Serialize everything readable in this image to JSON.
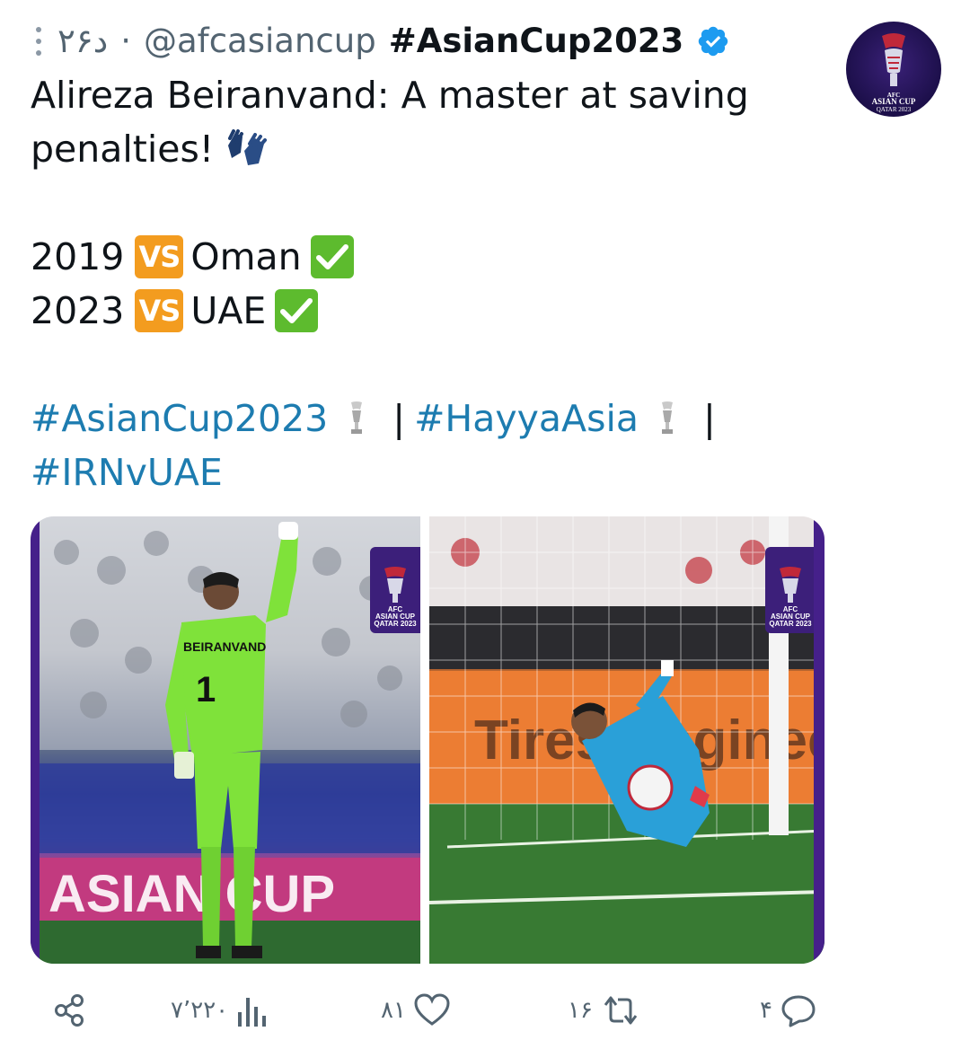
{
  "header": {
    "time": "۲۶د",
    "dot": "·",
    "handle": "@afcasiancup",
    "hashtag_display": "#AsianCup2023"
  },
  "tweet": {
    "line1": "Alireza Beiranvand: A master at saving",
    "line2": "penalties!",
    "match1_year": "2019",
    "match1_opponent": "Oman",
    "match2_year": "2023",
    "match2_opponent": "UAE",
    "vs_label": "VS",
    "hashtag1": "#AsianCup2023",
    "hashtag2": "#HayyaAsia",
    "hashtag3": "#IRNvUAE",
    "separator": "|"
  },
  "media": {
    "logo_line1": "AFC",
    "logo_line2": "ASIAN CUP",
    "logo_line3": "QATAR 2023",
    "left_jersey_name": "BEIRANVAND",
    "left_jersey_number": "1",
    "left_board_text": "ASIAN CUP",
    "right_board_text": "Tires Engineer"
  },
  "actions": {
    "views": "۷٬۲۲۰",
    "likes": "۸۱",
    "retweets": "۱۶",
    "replies": "۴"
  },
  "colors": {
    "hashtag": "#1d7cb0",
    "verified": "#1d9bf0",
    "vs_badge": "#f39c1f",
    "check_badge": "#5dbb2e",
    "brand_purple": "#3c1f7a"
  }
}
